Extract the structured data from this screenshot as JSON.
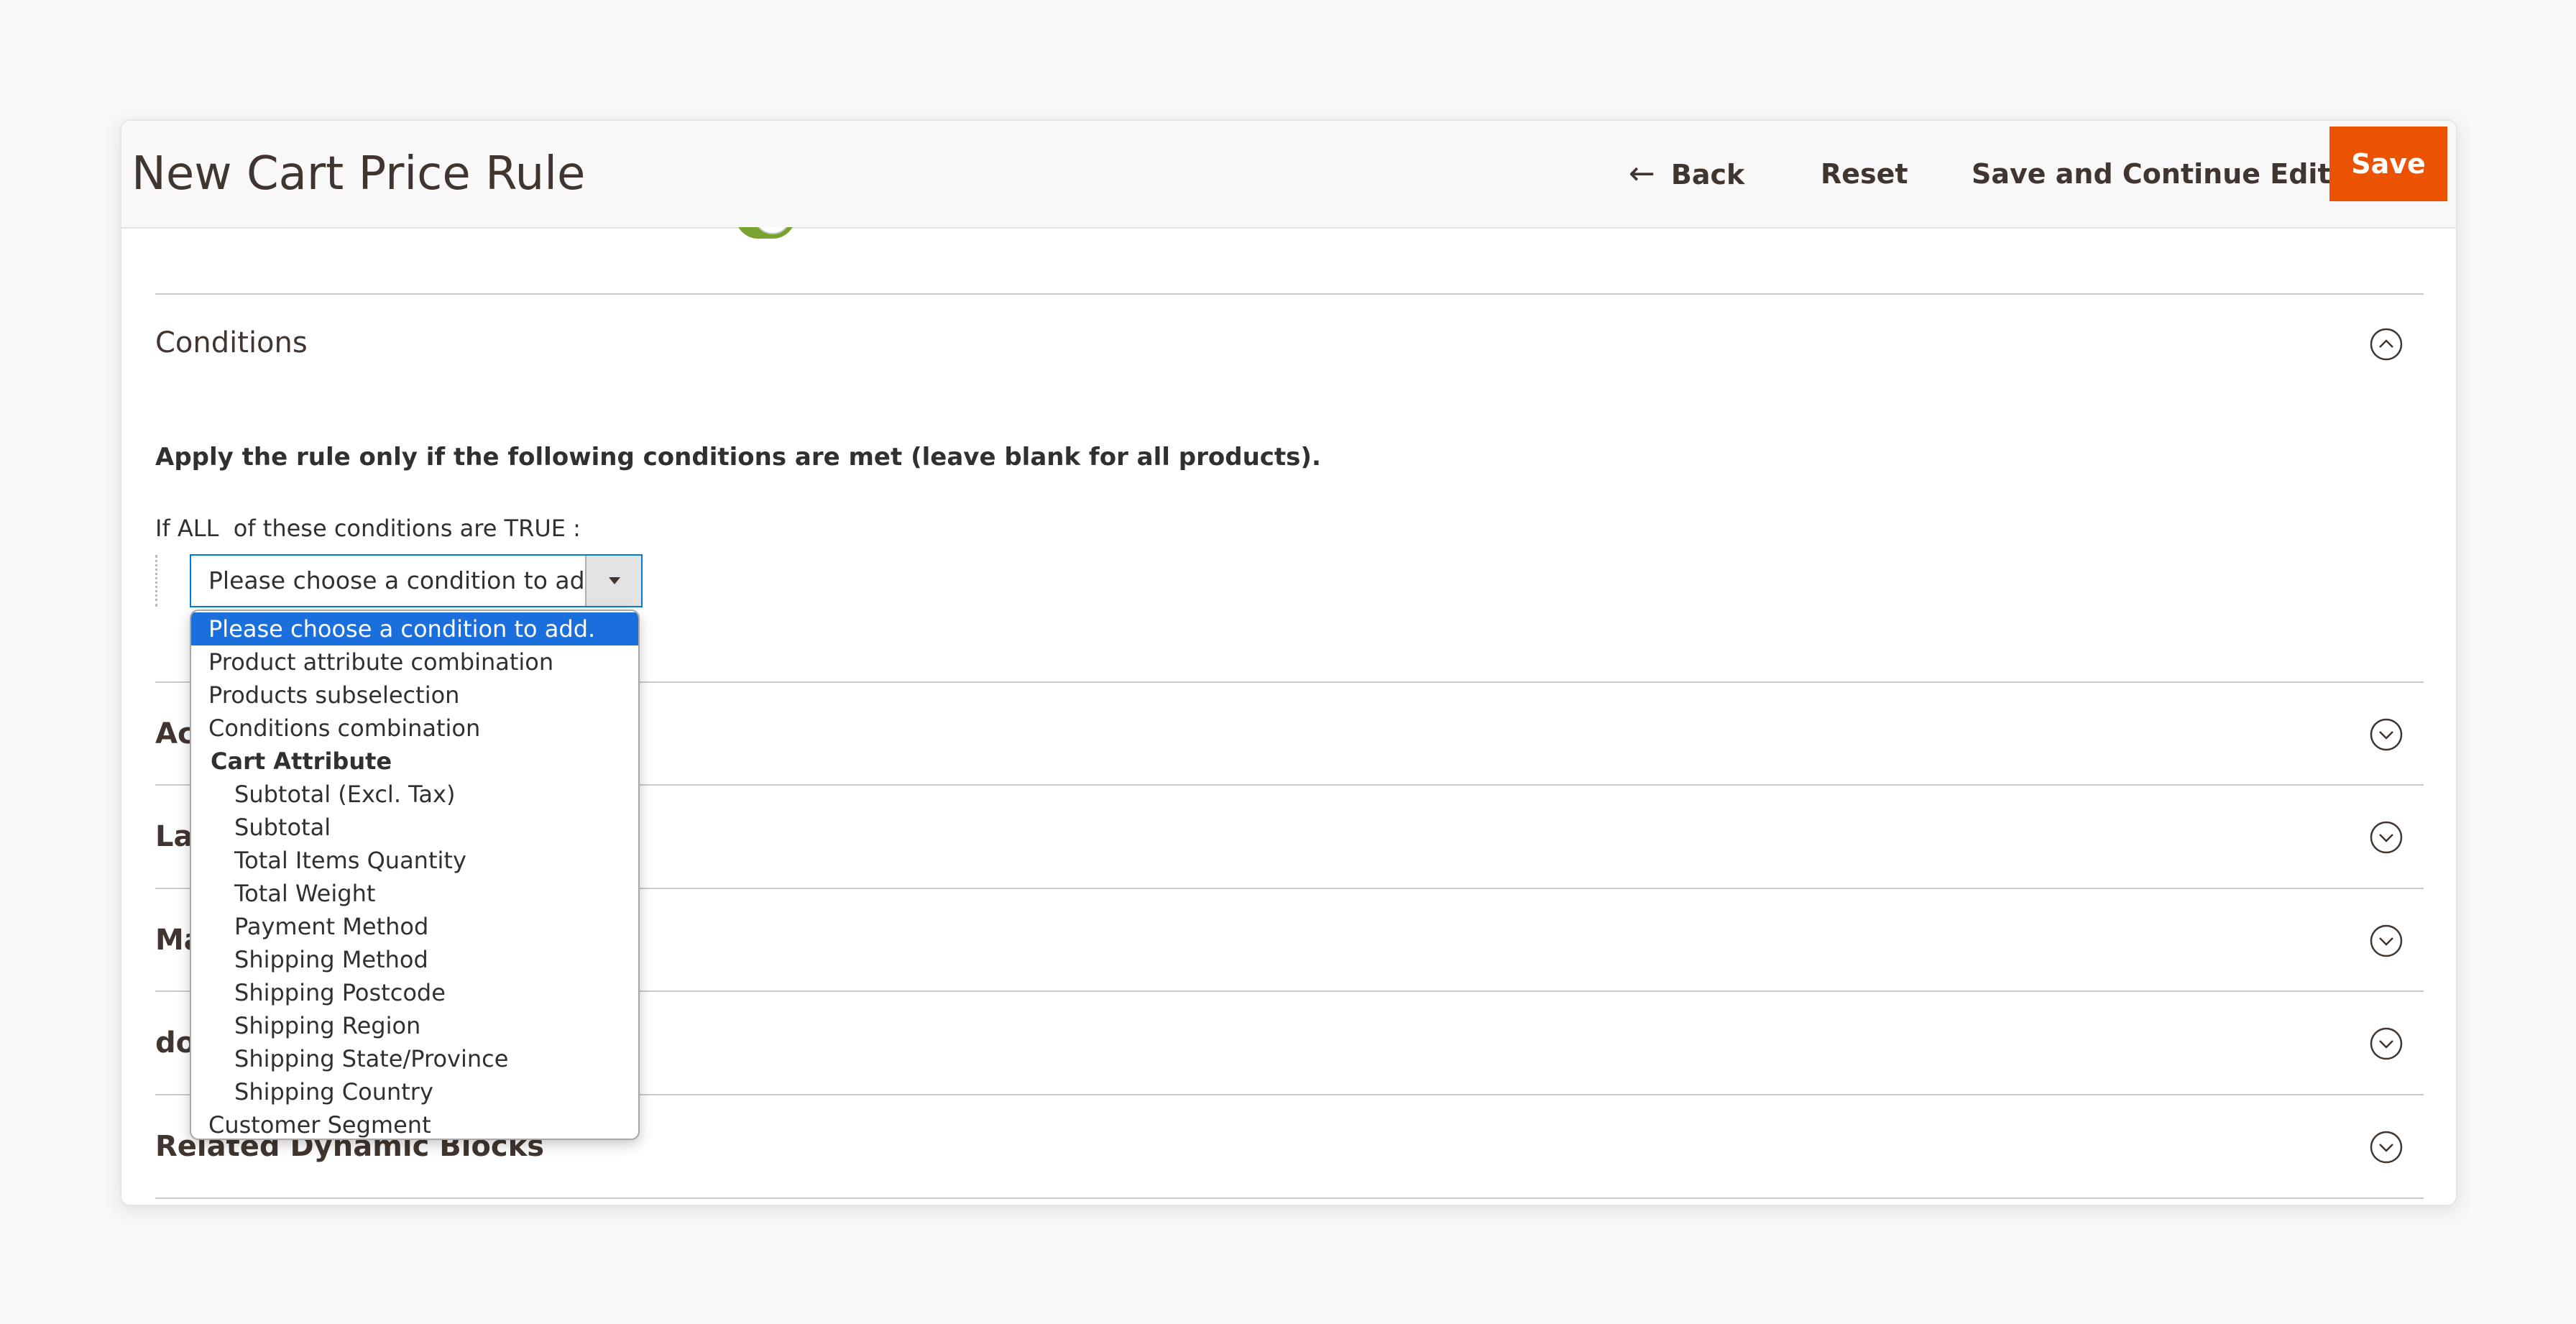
{
  "header": {
    "title": "New Cart Price Rule",
    "back_icon": "←",
    "back_label": "Back",
    "reset_label": "Reset",
    "save_continue_label": "Save and Continue Edit",
    "save_label": "Save",
    "save_color": "#eb5202"
  },
  "conditions": {
    "title": "Conditions",
    "apply_text": "Apply the rule only if the following conditions are met (leave blank for all products).",
    "if_prefix": "If",
    "aggregator": "ALL",
    "mid_text": "of these conditions are",
    "value": "TRUE",
    "suffix": ":",
    "select_value": "Please choose a condition to add.",
    "options": [
      {
        "label": "Please choose a condition to add.",
        "selected": true
      },
      {
        "label": "Product attribute combination"
      },
      {
        "label": "Products subselection"
      },
      {
        "label": "Conditions combination"
      },
      {
        "label": "Cart Attribute",
        "group": true
      },
      {
        "label": "Subtotal (Excl. Tax)",
        "indent": true
      },
      {
        "label": "Subtotal",
        "indent": true
      },
      {
        "label": "Total Items Quantity",
        "indent": true
      },
      {
        "label": "Total Weight",
        "indent": true
      },
      {
        "label": "Payment Method",
        "indent": true
      },
      {
        "label": "Shipping Method",
        "indent": true
      },
      {
        "label": "Shipping Postcode",
        "indent": true
      },
      {
        "label": "Shipping Region",
        "indent": true
      },
      {
        "label": "Shipping State/Province",
        "indent": true
      },
      {
        "label": "Shipping Country",
        "indent": true
      },
      {
        "label": "Customer Segment"
      }
    ]
  },
  "sections": [
    {
      "title": "Ac"
    },
    {
      "title": "La"
    },
    {
      "title": "Ma"
    },
    {
      "title": "do"
    },
    {
      "title": "Related Dynamic Blocks"
    }
  ],
  "colors": {
    "accent_blue": "#007bdb",
    "selected_option": "#1a6fdc",
    "toggle_green": "#79a22e"
  },
  "icons": {
    "collapse": "chevron-up-circle-icon",
    "expand": "chevron-down-circle-icon"
  }
}
